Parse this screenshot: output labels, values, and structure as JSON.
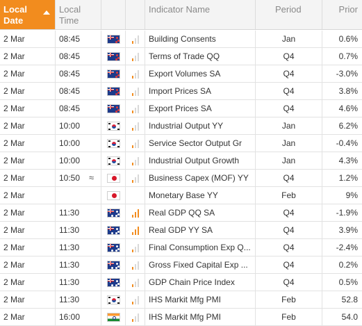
{
  "columns": {
    "date_l1": "Local",
    "date_l2": "Date",
    "time_l1": "Local",
    "time_l2": "Time",
    "name": "Indicator Name",
    "period": "Period",
    "prior": "Prior"
  },
  "colors": {
    "accent": "#f28c1e",
    "muted": "#d9d9d9"
  },
  "rows": [
    {
      "date": "2 Mar",
      "time": "08:45",
      "flag": "nz-flag",
      "importance": 1,
      "name": "Building Consents",
      "period": "Jan",
      "prior": "0.6%"
    },
    {
      "date": "2 Mar",
      "time": "08:45",
      "flag": "nz-flag",
      "importance": 1,
      "name": "Terms of Trade QQ",
      "period": "Q4",
      "prior": "0.7%"
    },
    {
      "date": "2 Mar",
      "time": "08:45",
      "flag": "nz-flag",
      "importance": 1,
      "name": "Export Volumes SA",
      "period": "Q4",
      "prior": "-3.0%"
    },
    {
      "date": "2 Mar",
      "time": "08:45",
      "flag": "nz-flag",
      "importance": 1,
      "name": "Import Prices SA",
      "period": "Q4",
      "prior": "3.8%"
    },
    {
      "date": "2 Mar",
      "time": "08:45",
      "flag": "nz-flag",
      "importance": 1,
      "name": "Export Prices SA",
      "period": "Q4",
      "prior": "4.6%"
    },
    {
      "date": "2 Mar",
      "time": "10:00",
      "flag": "kr-flag",
      "importance": 1,
      "name": "Industrial Output YY",
      "period": "Jan",
      "prior": "6.2%"
    },
    {
      "date": "2 Mar",
      "time": "10:00",
      "flag": "kr-flag",
      "importance": 1,
      "name": "Service Sector Output Gr",
      "period": "Jan",
      "prior": "-0.4%"
    },
    {
      "date": "2 Mar",
      "time": "10:00",
      "flag": "kr-flag",
      "importance": 1,
      "name": "Industrial Output Growth",
      "period": "Jan",
      "prior": "4.3%"
    },
    {
      "date": "2 Mar",
      "time": "10:50",
      "approx": "≈",
      "flag": "jp-flag",
      "importance": 1,
      "name": "Business Capex (MOF) YY",
      "period": "Q4",
      "prior": "1.2%"
    },
    {
      "date": "2 Mar",
      "time": "",
      "flag": "jp-flag",
      "importance": 0,
      "name": "Monetary Base YY",
      "period": "Feb",
      "prior": "9%"
    },
    {
      "date": "2 Mar",
      "time": "11:30",
      "flag": "au-flag",
      "importance": 3,
      "name": "Real GDP QQ SA",
      "period": "Q4",
      "prior": "-1.9%"
    },
    {
      "date": "2 Mar",
      "time": "11:30",
      "flag": "au-flag",
      "importance": 3,
      "name": "Real GDP YY SA",
      "period": "Q4",
      "prior": "3.9%"
    },
    {
      "date": "2 Mar",
      "time": "11:30",
      "flag": "au-flag",
      "importance": 1,
      "name": "Final Consumption Exp Q...",
      "period": "Q4",
      "prior": "-2.4%"
    },
    {
      "date": "2 Mar",
      "time": "11:30",
      "flag": "au-flag",
      "importance": 1,
      "name": "Gross Fixed Capital Exp ...",
      "period": "Q4",
      "prior": "0.2%"
    },
    {
      "date": "2 Mar",
      "time": "11:30",
      "flag": "au-flag",
      "importance": 1,
      "name": "GDP Chain Price Index",
      "period": "Q4",
      "prior": "0.5%"
    },
    {
      "date": "2 Mar",
      "time": "11:30",
      "flag": "kr-flag",
      "importance": 1,
      "name": "IHS Markit Mfg PMI",
      "period": "Feb",
      "prior": "52.8"
    },
    {
      "date": "2 Mar",
      "time": "16:00",
      "flag": "in-flag",
      "importance": 1,
      "name": "IHS Markit Mfg PMI",
      "period": "Feb",
      "prior": "54.0"
    }
  ]
}
